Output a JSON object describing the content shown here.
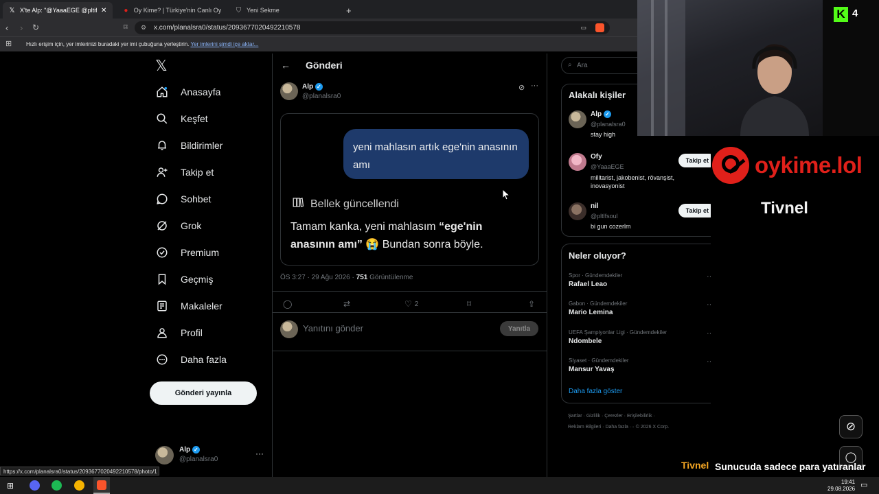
{
  "browser": {
    "tabs": [
      {
        "label": "X'te Alp: \"@YaaaEGE @pltifsoul",
        "active": true
      },
      {
        "label": "Oy Kime? | Türkiye'nin Canlı Oy Hari...",
        "active": false
      },
      {
        "label": "Yeni Sekme",
        "active": false
      }
    ],
    "url": "x.com/planalsra0/status/2093677020492210578",
    "bookmarks_text": "Hızlı erişim için, yer imlerinizi buradaki yer imi çubuğuna yerleştirin.",
    "bookmarks_link": "Yer imlerini şimdi içe aktar...",
    "status_url": "https://x.com/planalsra0/status/2093677020492210578/photo/1"
  },
  "nav": {
    "items": [
      {
        "label": "Anasayfa",
        "icon": "home-icon"
      },
      {
        "label": "Keşfet",
        "icon": "search-icon"
      },
      {
        "label": "Bildirimler",
        "icon": "bell-icon"
      },
      {
        "label": "Takip et",
        "icon": "person-add-icon"
      },
      {
        "label": "Sohbet",
        "icon": "chat-icon"
      },
      {
        "label": "Grok",
        "icon": "grok-icon"
      },
      {
        "label": "Premium",
        "icon": "premium-icon"
      },
      {
        "label": "Geçmiş",
        "icon": "bookmark-icon"
      },
      {
        "label": "Makaleler",
        "icon": "article-icon"
      },
      {
        "label": "Profil",
        "icon": "profile-icon"
      },
      {
        "label": "Daha fazla",
        "icon": "more-circle-icon"
      }
    ],
    "post_button": "Gönderi yayınla",
    "account": {
      "name": "Alp",
      "handle": "@planalsra0"
    }
  },
  "post": {
    "header_title": "Gönderi",
    "author_name": "Alp",
    "author_handle": "@planalsra0",
    "image_bubble": "yeni mahlasın artık ege'nin anasının amı",
    "memory_label": "Bellek güncellendi",
    "reply_text_part1": "Tamam kanka, yeni mahlasım ",
    "reply_text_bold": "“ege'nin anasının amı”",
    "reply_text_part2": " 😭 Bundan sonra böyle.",
    "timestamp": "ÖS 3:27 · 29 Ağu 2026 · ",
    "views_count": "751",
    "views_label": " Görüntülenme",
    "like_count": "2",
    "reply_placeholder": "Yanıtını gönder",
    "reply_button": "Yanıtla"
  },
  "sidebar": {
    "search_placeholder": "Ara",
    "relevant_title": "Alakalı kişiler",
    "people": [
      {
        "name": "Alp",
        "handle": "@planalsra0",
        "bio": "stay high",
        "verified": true,
        "follow": ""
      },
      {
        "name": "Ofy",
        "handle": "@YaaaEGE",
        "bio": "militarist, jakobenist, rövanşist, inovasyonist",
        "verified": false,
        "follow": "Takip et"
      },
      {
        "name": "nil",
        "handle": "@pltlfsoul",
        "bio": "bi gun cozerlm",
        "verified": false,
        "follow": "Takip et"
      }
    ],
    "trends_title": "Neler oluyor?",
    "trends": [
      {
        "category": "Spor · Gündemdekiler",
        "name": "Rafael Leao"
      },
      {
        "category": "Gabon · Gündemdekiler",
        "name": "Mario Lemina"
      },
      {
        "category": "UEFA Şampiyonlar Ligi · Gündemdekiler",
        "name": "Ndombele"
      },
      {
        "category": "Siyaset · Gündemdekiler",
        "name": "Mansur Yavaş"
      }
    ],
    "show_more": "Daha fazla göster",
    "footer_line1": "Şartlar · Gizlilik · Çerezler · Erişilebilirlik ·",
    "footer_line2": "Reklam Bilgileri · Daha fazla ··· © 2026 X Corp."
  },
  "overlay": {
    "kick_count": "4",
    "site_logo": "oykime.lol",
    "streamer_name": "Tivnel",
    "chat_user": "Tivnel",
    "chat_message": "Sunucuda sadece para yatıranlar kalacak böyle giderse",
    "clock_time": "19:41",
    "clock_date": "29.08.2026"
  },
  "colors": {
    "accent": "#1d9bf0",
    "kick_green": "#53fc18",
    "brand_red": "#e0201a",
    "bubble": "#1e3a6b"
  }
}
